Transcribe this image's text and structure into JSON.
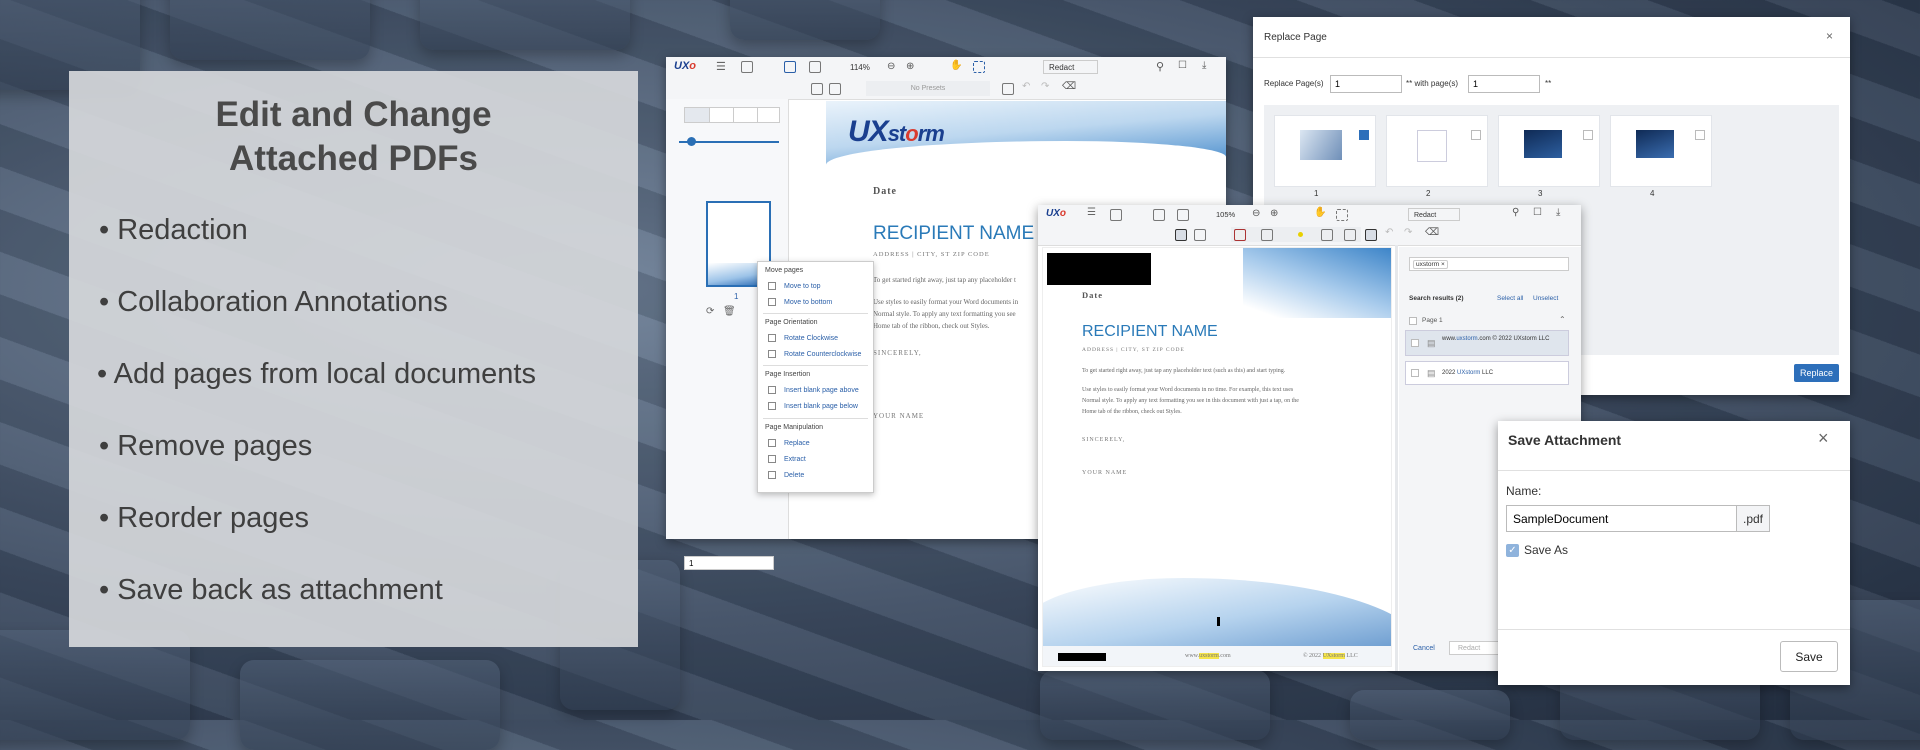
{
  "panel": {
    "title": "Edit and Change\nAttached PDFs",
    "features": [
      "Redaction",
      "Collaboration Annotations",
      "Add pages from local documents",
      "Remove pages",
      "Reorder pages",
      "Save back as attachment"
    ]
  },
  "viewer1": {
    "zoom": "114%",
    "mode": "Redact",
    "presets": "No Presets",
    "thumb_page_number": "1",
    "page_input": "1",
    "doc": {
      "date": "Date",
      "recipient": "RECIPIENT NAME",
      "address": "ADDRESS | CITY, ST ZIP CODE",
      "body1": "To get started right away, just tap any placeholder t",
      "body2": "Use styles to easily format your Word documents in",
      "body3": "Normal style. To apply any text formatting you see",
      "body4": "Home tab of the ribbon, check out Styles.",
      "sincerely": "SINCERELY,",
      "your_name": "YOUR NAME"
    },
    "context_menu": {
      "sections": [
        {
          "header": "Move pages",
          "items": [
            "Move to top",
            "Move to bottom"
          ]
        },
        {
          "header": "Page Orientation",
          "items": [
            "Rotate Clockwise",
            "Rotate Counterclockwise"
          ]
        },
        {
          "header": "Page Insertion",
          "items": [
            "Insert blank page above",
            "Insert blank page below"
          ]
        },
        {
          "header": "Page Manipulation",
          "items": [
            "Replace",
            "Extract",
            "Delete"
          ]
        }
      ]
    }
  },
  "logo": {
    "ux": "UX",
    "st": "st",
    "o": "o",
    "rm": "rm"
  },
  "replace_dialog": {
    "title": "Replace Page",
    "replace_label": "Replace Page(s)",
    "replace_value": "1",
    "with_label": "** with page(s)",
    "with_value": "1",
    "suffix": "**",
    "thumbs": [
      "1",
      "2",
      "3",
      "4"
    ],
    "button": "Replace"
  },
  "viewer2": {
    "zoom": "105%",
    "mode": "Redact",
    "doc": {
      "date": "Date",
      "recipient": "RECIPIENT NAME",
      "address": "ADDRESS | CITY, ST ZIP CODE",
      "body1": "To get started right away, just tap any placeholder text (such as this) and start typing.",
      "body2": "Use styles to easily format your Word documents in no time. For example, this text uses",
      "body3": "Normal style. To apply any text formatting you see in this document with just a tap, on the",
      "body4": "Home tab of the ribbon, check out Styles.",
      "sincerely": "SINCERELY,",
      "your_name": "YOUR NAME",
      "footer_www": "www.",
      "footer_domain": "uxstorm",
      "footer_tld": ".com",
      "footer_copy": "© 2022",
      "footer_name": "UXstorm",
      "footer_llc": "LLC"
    },
    "search": {
      "tag": "uxstorm",
      "results_label": "Search results (2)",
      "select_all": "Select all",
      "unselect": "Unselect",
      "page_label": "Page 1",
      "result1_pre": "www.",
      "result1_hit": "uxstorm",
      "result1_post": ".com © 2022 UXstorm LLC",
      "result2_pre": "2022 ",
      "result2_hit": "UXstorm",
      "result2_post": " LLC",
      "cancel": "Cancel",
      "redact": "Redact"
    }
  },
  "save_dialog": {
    "title": "Save Attachment",
    "name_label": "Name:",
    "name_value": "SampleDocument",
    "ext": ".pdf",
    "save_as": "Save As",
    "save_button": "Save"
  }
}
